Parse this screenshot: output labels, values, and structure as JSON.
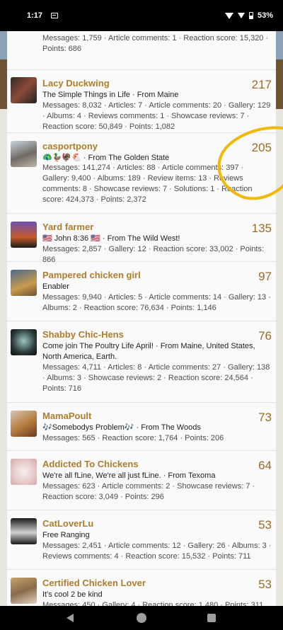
{
  "status": {
    "time": "1:17",
    "battery": "53%"
  },
  "members": [
    {
      "name": "",
      "score": "",
      "about": "",
      "stats": "Messages: 1,759 · Article comments: 1 · Reaction score: 15,320 · Points: 686"
    },
    {
      "name": "Lacy Duckwing",
      "score": "217",
      "about": "The Simple Things in Life · From Maine",
      "stats": "Messages: 8,032 · Articles: 7 · Article comments: 20 · Gallery: 129 · Albums: 4 · Reviews comments: 1 · Showcase reviews: 7 · Reaction score: 50,849 · Points: 1,082"
    },
    {
      "name": "casportpony",
      "score": "205",
      "about": "🦚🦆🦃🐔 · From The Golden State",
      "stats": "Messages: 141,274 · Articles: 88 · Article comments: 397 · Gallery: 9,400 · Albums: 189 · Review items: 13 · Reviews comments: 8 · Showcase reviews: 7 · Solutions: 1 · Reaction score: 424,373 · Points: 2,372"
    },
    {
      "name": "Yard farmer",
      "score": "135",
      "about": "🇺🇸 John 8:36 🇺🇸 · From The Wild West!",
      "stats": "Messages: 2,857 · Gallery: 12 · Reaction score: 33,002 · Points: 866"
    },
    {
      "name": "Pampered chicken girl",
      "score": "97",
      "about": "Enabler",
      "stats": "Messages: 9,940 · Articles: 5 · Article comments: 14 · Gallery: 13 · Albums: 2 · Reaction score: 76,634 · Points: 1,146"
    },
    {
      "name": "Shabby Chic-Hens",
      "score": "76",
      "about": "Come join The Poultry Life April! · From Maine, United States, North America, Earth.",
      "stats": "Messages: 4,711 · Articles: 8 · Article comments: 27 · Gallery: 138 · Albums: 3 · Showcase reviews: 2 · Reaction score: 24,564 · Points: 716"
    },
    {
      "name": "MamaPoult",
      "score": "73",
      "about": "🎶Somebodys Problem🎶 · From The Woods",
      "stats": "Messages: 565 · Reaction score: 1,764 · Points: 206"
    },
    {
      "name": "Addicted To Chickens",
      "score": "64",
      "about": "We're all fLine, We're all just fLine. · From Texoma",
      "stats": "Messages: 623 · Article comments: 2 · Showcase reviews: 7 · Reaction score: 3,049 · Points: 296"
    },
    {
      "name": "CatLoverLu",
      "score": "53",
      "about": "Free Ranging",
      "stats": "Messages: 2,451 · Article comments: 12 · Gallery: 26 · Albums: 3 · Reviews comments: 4 · Reaction score: 15,532 · Points: 711"
    },
    {
      "name": "Certified Chicken Lover",
      "score": "53",
      "about": "It's cool 2 be kind",
      "stats": "Messages: 450 · Gallery: 4 · Reaction score: 1,480 · Points: 311"
    }
  ],
  "colors": {
    "name": "#ae7d2b",
    "score": "#9b6c28",
    "highlight": "#f2b807"
  }
}
